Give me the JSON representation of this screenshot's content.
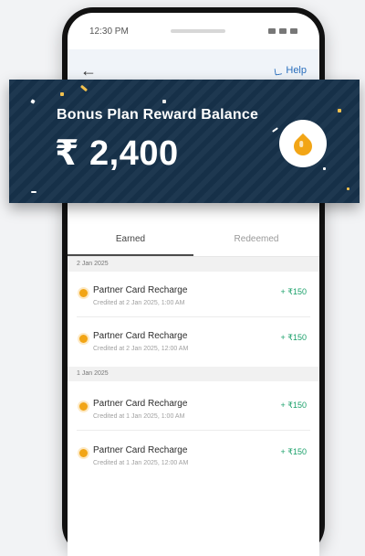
{
  "statusbar": {
    "time": "12:30 PM"
  },
  "appbar": {
    "back_icon": "arrow-left-icon",
    "help_label": "Help",
    "help_icon": "phone-icon"
  },
  "banner": {
    "title": "Bonus Plan Reward Balance",
    "amount": "₹ 2,400",
    "icon": "drop-coin-icon",
    "background_color": "#17324a",
    "coin_color": "#f2a516"
  },
  "tabs": [
    {
      "label": "Earned",
      "active": true
    },
    {
      "label": "Redeemed",
      "active": false
    }
  ],
  "groups": [
    {
      "date": "2 Jan 2025",
      "items": [
        {
          "title": "Partner Card Recharge",
          "subtitle": "Credited at 2 Jan 2025, 1:00 AM",
          "amount": "+ ₹150"
        },
        {
          "title": "Partner Card Recharge",
          "subtitle": "Credited at 2 Jan 2025, 12:00 AM",
          "amount": "+ ₹150"
        }
      ]
    },
    {
      "date": "1 Jan 2025",
      "items": [
        {
          "title": "Partner Card Recharge",
          "subtitle": "Credited at 1 Jan 2025, 1:00 AM",
          "amount": "+ ₹150"
        },
        {
          "title": "Partner Card Recharge",
          "subtitle": "Credited at 1 Jan 2025, 12:00 AM",
          "amount": "+ ₹150"
        }
      ]
    }
  ],
  "accent_colors": {
    "positive": "#1aa06a",
    "help_link": "#2a6fbd"
  }
}
